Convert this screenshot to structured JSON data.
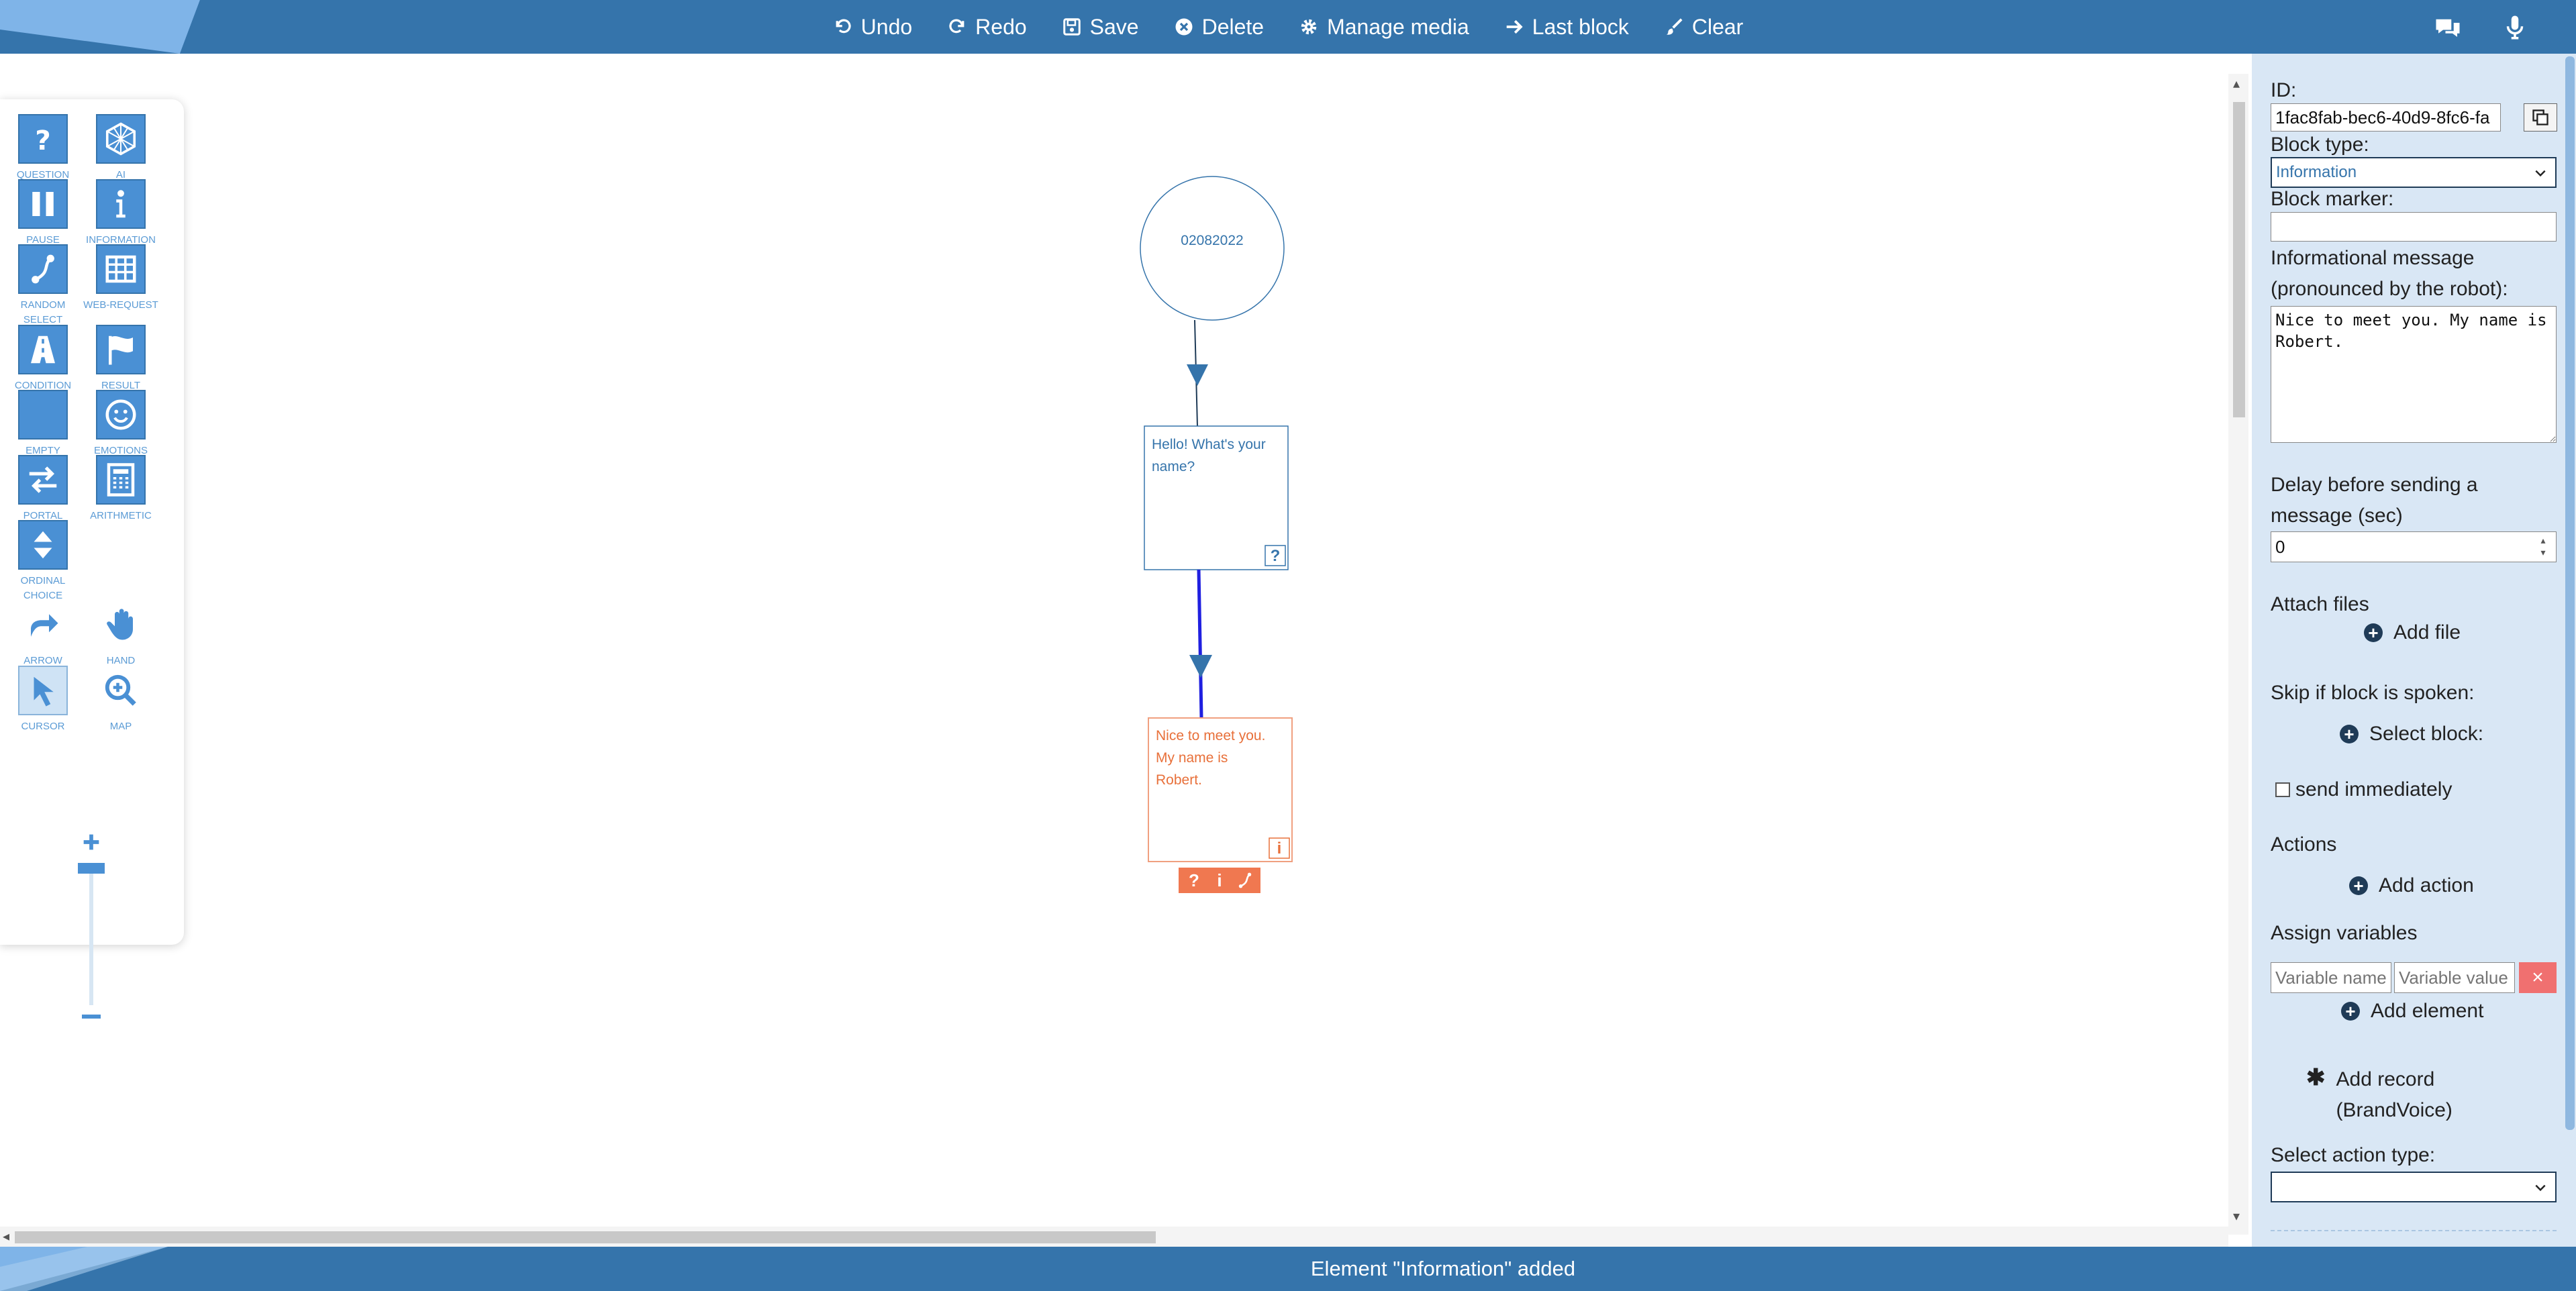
{
  "colors": {
    "brand": "#3574ab",
    "panel_bg": "#d9e7f5",
    "info_node": "#e8703a",
    "question_node": "#3574ab",
    "active_edge": "#2020e0",
    "delete_red": "#f07070"
  },
  "toolbar": {
    "undo": "Undo",
    "redo": "Redo",
    "save": "Save",
    "delete": "Delete",
    "manage_media": "Manage media",
    "last_block": "Last block",
    "clear": "Clear"
  },
  "top_right_icons": [
    "chat-icon",
    "microphone-icon"
  ],
  "palette": {
    "tools": [
      {
        "label": "QUESTION",
        "icon": "question-icon"
      },
      {
        "label": "AI",
        "icon": "ai-icon"
      },
      {
        "label": "PAUSE",
        "icon": "pause-icon"
      },
      {
        "label": "INFORMATION",
        "icon": "information-icon"
      },
      {
        "label": "RANDOM SELECT",
        "icon": "random-select-icon"
      },
      {
        "label": "WEB-REQUEST",
        "icon": "web-request-icon"
      },
      {
        "label": "CONDITION",
        "icon": "condition-icon"
      },
      {
        "label": "RESULT",
        "icon": "result-icon"
      },
      {
        "label": "EMPTY",
        "icon": "empty-icon"
      },
      {
        "label": "EMOTIONS",
        "icon": "emotions-icon"
      },
      {
        "label": "PORTAL",
        "icon": "portal-icon"
      },
      {
        "label": "ARITHMETIC",
        "icon": "arithmetic-icon"
      },
      {
        "label": "ORDINAL CHOICE",
        "icon": "ordinal-choice-icon"
      },
      {
        "label": "ARROW",
        "icon": "arrow-icon"
      },
      {
        "label": "HAND",
        "icon": "hand-icon"
      },
      {
        "label": "CURSOR",
        "icon": "cursor-icon"
      },
      {
        "label": "MAP",
        "icon": "map-icon"
      }
    ],
    "zoom_plus": "+",
    "zoom_minus": "−"
  },
  "canvas": {
    "start_node": "02082022",
    "question_node": "Hello! What's your name?",
    "question_badge": "?",
    "info_node": "Nice to meet you. My name is Robert.",
    "info_badge": "i",
    "node_quick_actions": [
      "?",
      "i",
      "random"
    ]
  },
  "panel": {
    "id_label": "ID:",
    "id_value": "1fac8fab-bec6-40d9-8fc6-fa",
    "block_type_label": "Block type:",
    "block_type_value": "Information",
    "block_marker_label": "Block marker:",
    "block_marker_value": "",
    "info_message_label_1": "Informational message",
    "info_message_label_2": "(pronounced by the robot):",
    "info_message_value": "Nice to meet you. My name is Robert.",
    "delay_label_1": "Delay before sending a",
    "delay_label_2": "message (sec)",
    "delay_value": "0",
    "attach_files_label": "Attach files",
    "add_file": "Add file",
    "skip_label": "Skip if block is spoken:",
    "select_block": "Select block:",
    "send_immediately": "send immediately",
    "send_immediately_checked": false,
    "actions_label": "Actions",
    "add_action": "Add action",
    "assign_variables_label": "Assign variables",
    "variable_name_placeholder": "Variable name",
    "variable_value_placeholder": "Variable value",
    "remove_variable": "×",
    "add_element": "Add element",
    "add_record_1": "Add record",
    "add_record_2": "(BrandVoice)",
    "select_action_type_label": "Select action type:",
    "select_action_type_value": ""
  },
  "status": {
    "message": "Element \"Information\" added"
  }
}
